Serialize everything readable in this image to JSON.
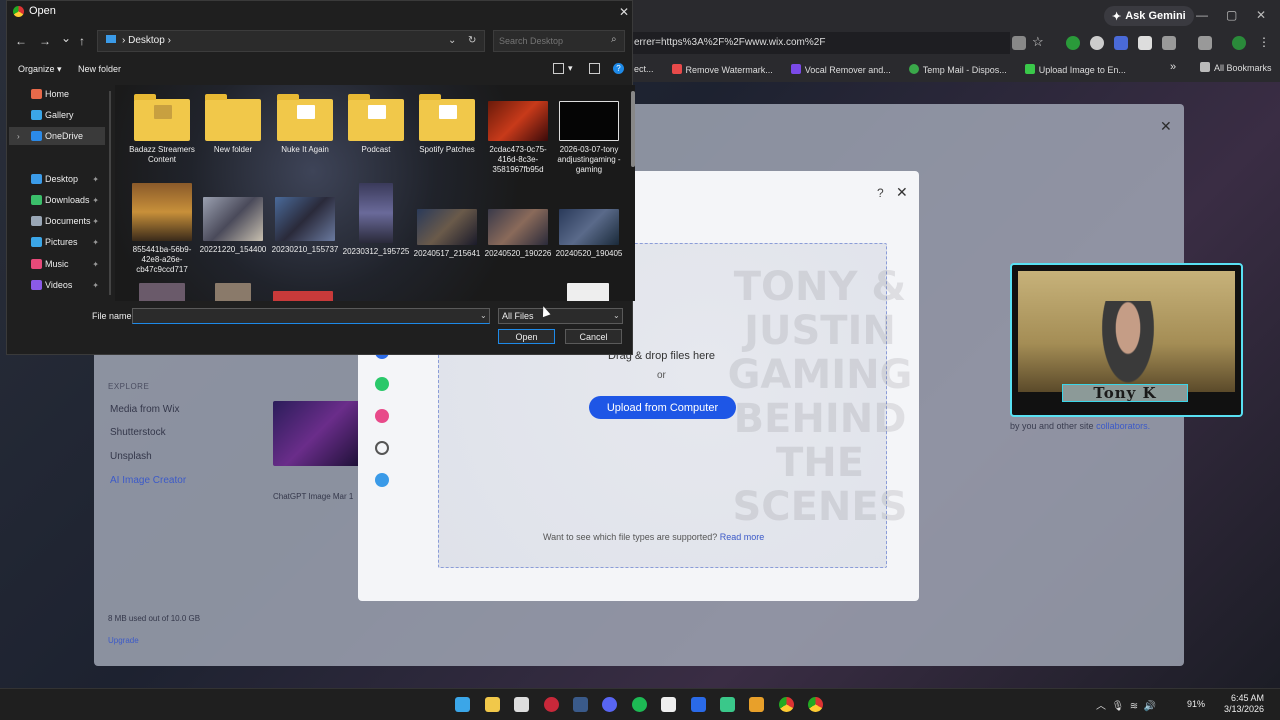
{
  "browser": {
    "gemini_label": "Ask Gemini",
    "url": "errer=https%3A%2F%2Fwww.wix.com%2F",
    "bookmarks": [
      "ect...",
      "Remove Watermark...",
      "Vocal Remover and...",
      "Temp Mail - Dispos...",
      "Upload Image to En..."
    ],
    "all_bookmarks": "All Bookmarks",
    "more_chevron": "»"
  },
  "wix": {
    "explore_label": "EXPLORE",
    "media_from_wix": "Media from Wix",
    "shutterstock": "Shutterstock",
    "unsplash": "Unsplash",
    "ai_creator": "AI Image Creator",
    "storage_text": "8 MB used out of 10.0 GB",
    "upgrade": "Upgrade",
    "thumb_caption": "ChatGPT Image Mar 1",
    "right_text": "by you and other site",
    "right_link": "collaborators."
  },
  "modal": {
    "help": "?",
    "close": "✕",
    "watermark": "TONY & JUSTIN GAMING BEHIND THE SCENES",
    "drag_text": "Drag & drop files here",
    "or_text": "or",
    "upload_button": "Upload from Computer",
    "types_question": "Want to see which file types are supported?",
    "read_more": "Read more"
  },
  "webcam": {
    "name": "Tony K"
  },
  "dialog": {
    "title": "Open",
    "close": "✕",
    "back": "←",
    "forward": "→",
    "recent": "⌄",
    "up": "↑",
    "breadcrumb_sep": "›",
    "breadcrumb": "Desktop",
    "search_placeholder": "Search Desktop",
    "organize": "Organize ▾",
    "new_folder": "New folder",
    "help": "?",
    "sidebar": [
      {
        "label": "Home",
        "color": "#e86a4a"
      },
      {
        "label": "Gallery",
        "color": "#3ba6e8"
      },
      {
        "label": "OneDrive",
        "color": "#2b8ae8"
      },
      {
        "label": "Desktop",
        "color": "#3b9be8"
      },
      {
        "label": "Downloads",
        "color": "#3bbf6a"
      },
      {
        "label": "Documents",
        "color": "#9aa7b6"
      },
      {
        "label": "Pictures",
        "color": "#3ba6e8"
      },
      {
        "label": "Music",
        "color": "#e84a7a"
      },
      {
        "label": "Videos",
        "color": "#8a5ae8"
      }
    ],
    "files": [
      {
        "name": "Badazz Streamers Content",
        "kind": "folder"
      },
      {
        "name": "New folder",
        "kind": "folder"
      },
      {
        "name": "Nuke It Again",
        "kind": "folder"
      },
      {
        "name": "Podcast",
        "kind": "folder"
      },
      {
        "name": "Spotify Patches",
        "kind": "folder"
      },
      {
        "name": "2cdac473-0c75-416d-8c3e-3581967fb95d",
        "kind": "image"
      },
      {
        "name": "2026-03-07-tony andjustingaming -gaming",
        "kind": "image"
      },
      {
        "name": "855441ba-56b9-42e8-a26e-cb47c9ccd717",
        "kind": "image"
      },
      {
        "name": "20221220_154400",
        "kind": "image"
      },
      {
        "name": "20230210_155737",
        "kind": "image"
      },
      {
        "name": "20230312_195725",
        "kind": "image"
      },
      {
        "name": "20240517_215641",
        "kind": "image"
      },
      {
        "name": "20240520_190226",
        "kind": "image"
      },
      {
        "name": "20240520_190405",
        "kind": "image"
      }
    ],
    "file_name_label": "File name:",
    "file_name_value": "",
    "filter": "All Files",
    "open_button": "Open",
    "cancel_button": "Cancel"
  },
  "taskbar": {
    "battery": "91%",
    "time": "6:45 AM",
    "date": "3/13/2026"
  }
}
